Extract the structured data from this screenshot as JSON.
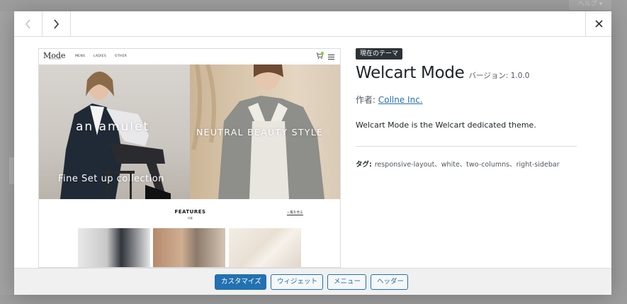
{
  "backdrop": {
    "help_label": "ヘルプ ▾"
  },
  "modal": {
    "nav": {
      "prev_icon": "chevron-left-icon",
      "next_icon": "chevron-right-icon",
      "close_icon": "close-icon"
    },
    "preview": {
      "logo": "Mode",
      "logo_sub": "WELCART",
      "menu": [
        "MENS",
        "LADIES",
        "OTHER"
      ],
      "hero_left_title": "an amulet",
      "hero_left_sub": "Fine Set up collection",
      "hero_right_title": "NEUTRAL BEAUTY STYLE",
      "features_title": "FEATURES",
      "features_sub": "特集",
      "view_all": "一覧を見る"
    },
    "info": {
      "current_badge": "現在のテーマ",
      "title": "Welcart Mode",
      "version": "バージョン: 1.0.0",
      "author_label": "作者: ",
      "author_name": "Collne Inc.",
      "description": "Welcart Mode is the Welcart dedicated theme.",
      "tags_label": "タグ:",
      "tags": "responsive-layout、white、two-columns、right-sidebar"
    },
    "footer": {
      "customize": "カスタマイズ",
      "widgets": "ウィジェット",
      "menus": "メニュー",
      "header": "ヘッダー"
    }
  },
  "colors": {
    "primary": "#2271b1",
    "badge": "#2c3338",
    "footer_bg": "#f0f0f1"
  }
}
